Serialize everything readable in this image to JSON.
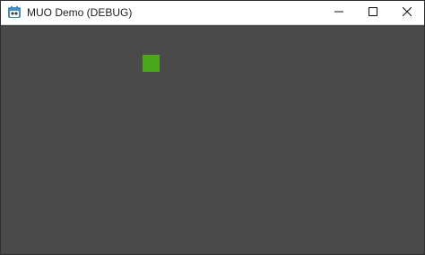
{
  "window": {
    "title": "MUO Demo (DEBUG)",
    "icon": "godot-engine-icon",
    "controls": [
      "minimize-icon",
      "maximize-icon",
      "close-icon"
    ]
  },
  "scene": {
    "background_color": "#4a4a4a",
    "sprite": {
      "name": "green-square-sprite",
      "color": "#4aa61b"
    }
  }
}
